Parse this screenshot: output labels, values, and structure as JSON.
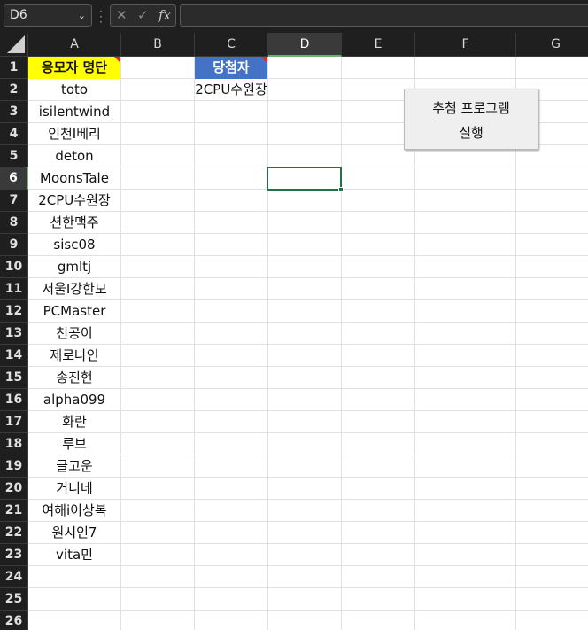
{
  "formula_bar": {
    "name_box": "D6",
    "name_box_dropdown": "chevron-down-icon",
    "cancel_icon": "✕",
    "enter_icon": "✓",
    "fx_label": "fx",
    "formula": ""
  },
  "columns": [
    "A",
    "B",
    "C",
    "D",
    "E",
    "F",
    "G"
  ],
  "selected_column": "D",
  "rows": [
    "1",
    "2",
    "3",
    "4",
    "5",
    "6",
    "7",
    "8",
    "9",
    "10",
    "11",
    "12",
    "13",
    "14",
    "15",
    "16",
    "17",
    "18",
    "19",
    "20",
    "21",
    "22",
    "23",
    "24",
    "25",
    "26"
  ],
  "selected_row": "6",
  "sheet": {
    "A1": "응모자 명단",
    "C1": "당첨자",
    "C2": "2CPU수원장",
    "applicants": [
      "toto",
      "isilentwind",
      "인천I베리",
      "deton",
      "MoonsTale",
      "2CPU수원장",
      "션한맥주",
      "sisc08",
      "gmltj",
      "서울I강한모",
      "PCMaster",
      "천공이",
      "제로나인",
      "송진현",
      "alpha099",
      "화란",
      "루브",
      "글고운",
      "거니네",
      "여해i이상복",
      "원시인7",
      "vita민"
    ]
  },
  "button": {
    "line1": "추첨 프로그램",
    "line2": "실행"
  },
  "colors": {
    "header_yellow": "#ffff00",
    "header_blue": "#4472c4",
    "selection_green": "#217346"
  }
}
